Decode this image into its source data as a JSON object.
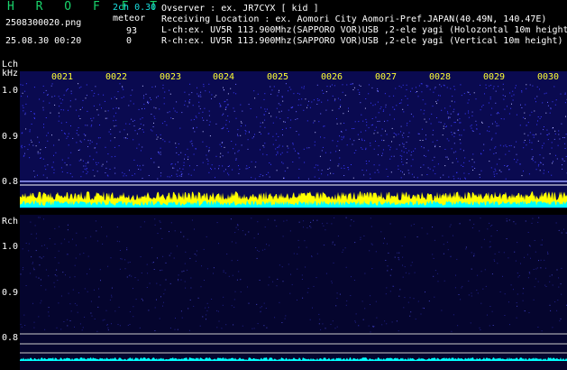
{
  "header": {
    "logo": "H R O F F T",
    "filename": "2508300020.png",
    "datetime": "25.08.30 00:20",
    "mode": "2ch 0.30",
    "meteor_label": "meteor",
    "count_l": "93",
    "count_r": "0"
  },
  "info": {
    "observer": "Ovserver             : ex. JR7CYX [ kid ]",
    "location": "Receiving Location : ex. Aomori City Aomori-Pref.JAPAN(40.49N, 140.47E)",
    "lch": "L-ch:ex. UV5R 113.900Mhz(SAPPORO VOR)USB ,2-ele yagi (Holozontal 10m height)",
    "rch": "R-ch:ex. UV5R 113.900Mhz(SAPPORO VOR)USB ,2-ele yagi (Vertical 10m height)"
  },
  "lch_panel": {
    "channel_label": "Lch",
    "unit_label": "kHz",
    "ticks": [
      "1.0",
      "0.9",
      "0.8"
    ],
    "time_labels": [
      "0021",
      "0022",
      "0023",
      "0024",
      "0025",
      "0026",
      "0027",
      "0028",
      "0029",
      "0030"
    ]
  },
  "rch_panel": {
    "channel_label": "Rch",
    "ticks": [
      "1.0",
      "0.9",
      "0.8"
    ]
  },
  "colors": {
    "background": "#000000",
    "spectrum_bg": "#0a0a50",
    "meteor_trace": "#ffff00",
    "noise_trace": "#00ffff",
    "logo": "#19d36b"
  }
}
